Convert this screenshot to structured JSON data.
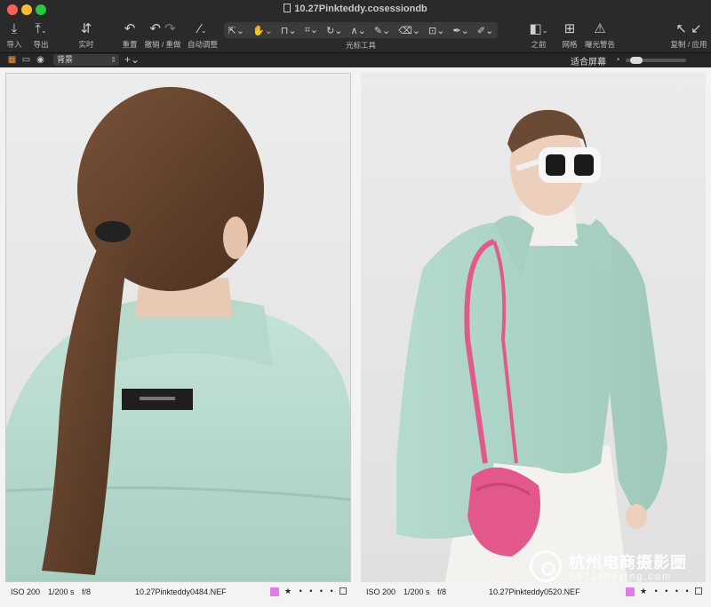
{
  "window": {
    "title": "10.27Pinkteddy.cosessiondb"
  },
  "toolbar": {
    "import": {
      "icon": "import-icon",
      "label": "导入"
    },
    "export": {
      "icon": "export-icon",
      "label": "导出"
    },
    "live": {
      "icon": "tether-icon",
      "label": "实时"
    },
    "reset": {
      "icon": "reset-icon",
      "label": "重置"
    },
    "undo_redo": {
      "icon": "undo-redo-icon",
      "label": "撤销 / 重做"
    },
    "auto_adjust": {
      "icon": "magic-wand-icon",
      "label": "自动调整"
    },
    "cursor_tools": {
      "label": "光标工具",
      "tools": [
        "select-tool",
        "pan-tool",
        "loupe-tool",
        "crop-tool",
        "rotate-tool",
        "keystone-tool",
        "brush-tool",
        "eraser-tool",
        "spot-removal-tool",
        "picker-tool",
        "annotation-tool"
      ]
    },
    "before": {
      "icon": "before-after-icon",
      "label": "之前"
    },
    "grid": {
      "icon": "grid-icon",
      "label": "网格"
    },
    "exposure_warning": {
      "icon": "warning-icon",
      "label": "曝光警告"
    },
    "copy_apply": {
      "icon": "copy-apply-icon",
      "label": "复制 / 应用"
    }
  },
  "subbar": {
    "background_select": "背景",
    "fit_label": "适合屏幕",
    "zoom_level": 0.1
  },
  "images": [
    {
      "iso": "ISO 200",
      "shutter": "1/200 s",
      "aperture": "f/8",
      "filename": "10.27Pinkteddy0484.NEF",
      "color_tag": "#e07be8",
      "stars": "★ • • • •"
    },
    {
      "iso": "ISO 200",
      "shutter": "1/200 s",
      "aperture": "f/8",
      "filename": "10.27Pinkteddy0520.NEF",
      "color_tag": "#e07be8",
      "stars": "★ • • • •"
    }
  ],
  "watermark": {
    "cn": "杭州电商摄影圈",
    "en": "0571sheying.com"
  }
}
